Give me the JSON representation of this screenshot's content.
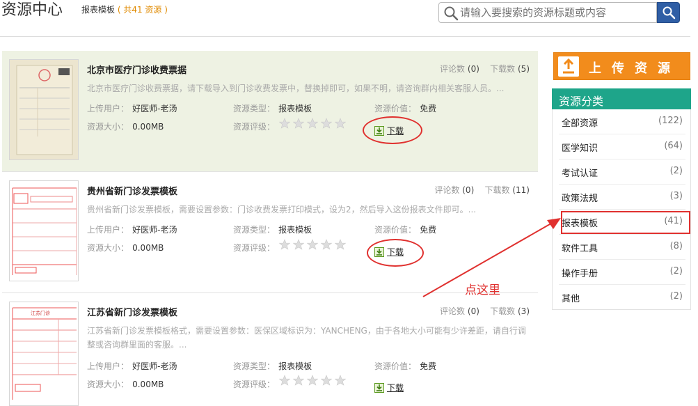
{
  "header": {
    "title": "资源中心",
    "breadcrumb": "报表模板",
    "count_text": "( 共41 资源 )",
    "search_placeholder": "请输入要搜索的资源标题或内容"
  },
  "labels": {
    "comments": "评论数",
    "downloads": "下载数",
    "uploader": "上传用户：",
    "type": "资源类型：",
    "value": "资源价值：",
    "size": "资源大小：",
    "rating": "资源评级：",
    "download": "下载"
  },
  "resources": [
    {
      "title": "北京市医疗门诊收费票据",
      "comments": "(0)",
      "downloads": "(5)",
      "desc": "北京市医疗门诊收费票据，请下载导入到门诊收费发票中，替换掉即可，如果不明，请咨询群内相关客服人员。...",
      "uploader": "好医师-老汤",
      "type": "报表模板",
      "value": "免费",
      "size": "0.00MB",
      "rating": 0
    },
    {
      "title": "贵州省新门诊发票模板",
      "comments": "(0)",
      "downloads": "(11)",
      "desc": "贵州省新门诊发票模板，需要设置参数：门诊收费发票打印模式，设为2，然后导入这份报表文件即可。...",
      "uploader": "好医师-老汤",
      "type": "报表模板",
      "value": "免费",
      "size": "0.00MB",
      "rating": 0
    },
    {
      "title": "江苏省新门诊发票模板",
      "comments": "(0)",
      "downloads": "(3)",
      "desc": "江苏省新门诊发票模板格式，需要设置参数：医保区域标识为：YANCHENG，由于各地大小可能有少许差距，请自行调整或咨询群里面的客服。...",
      "uploader": "好医师-老汤",
      "type": "报表模板",
      "value": "免费",
      "size": "0.00MB",
      "rating": 0
    }
  ],
  "sidebar": {
    "upload_label": "上传资源",
    "category_title": "资源分类",
    "categories": [
      {
        "label": "全部资源",
        "count": "(122)"
      },
      {
        "label": "医学知识",
        "count": "(64)"
      },
      {
        "label": "考试认证",
        "count": "(2)"
      },
      {
        "label": "政策法规",
        "count": "(3)"
      },
      {
        "label": "报表模板",
        "count": "(41)"
      },
      {
        "label": "软件工具",
        "count": "(8)"
      },
      {
        "label": "操作手册",
        "count": "(2)"
      },
      {
        "label": "其他",
        "count": "(2)"
      }
    ]
  },
  "annotation": {
    "note": "点这里",
    "color": "#e0312f"
  }
}
